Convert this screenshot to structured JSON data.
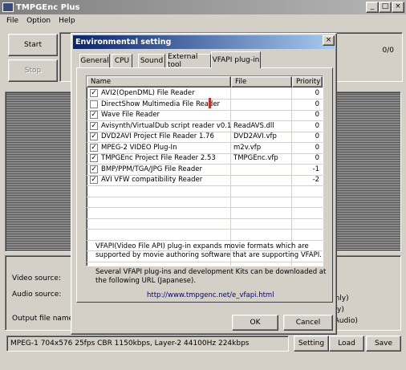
{
  "app": {
    "title": "TMPGEnc Plus"
  },
  "menu": [
    "File",
    "Option",
    "Help"
  ],
  "main": {
    "start_label": "Start",
    "stop_label": "Stop",
    "progress_count": "0/0",
    "video_source_label": "Video source:",
    "audio_source_label": "Audio source:",
    "output_label": "Output file name:",
    "right_texts": [
      "y",
      "y",
      "Video only)",
      "udio only)",
      "Video+Audio)"
    ],
    "status": "MPEG-1 704x576 25fps CBR 1150kbps, Layer-2 44100Hz 224kbps",
    "setting_label": "Setting",
    "load_label": "Load",
    "save_label": "Save"
  },
  "dialog": {
    "title": "Environmental setting",
    "tabs": [
      "General",
      "CPU",
      "Sound",
      "External tool",
      "VFAPI plug-in"
    ],
    "columns": [
      "Name",
      "File",
      "Priority"
    ],
    "plugins": [
      {
        "name": "AVI2(OpenDML) File Reader",
        "file": "",
        "priority": "0",
        "checked": true
      },
      {
        "name": "DirectShow Multimedia File Reader",
        "file": "",
        "priority": "0",
        "checked": false
      },
      {
        "name": "Wave File Reader",
        "file": "",
        "priority": "0",
        "checked": true
      },
      {
        "name": "Avisynth/VirtualDub script reader v0.1",
        "file": "ReadAVS.dll",
        "priority": "0",
        "checked": true
      },
      {
        "name": "DVD2AVI Project File Reader 1.76",
        "file": "DVD2AVI.vfp",
        "priority": "0",
        "checked": true
      },
      {
        "name": "MPEG-2 VIDEO Plug-In",
        "file": "m2v.vfp",
        "priority": "0",
        "checked": true
      },
      {
        "name": "TMPGEnc Project File Reader 2.53",
        "file": "TMPGEnc.vfp",
        "priority": "0",
        "checked": true
      },
      {
        "name": "BMP/PPM/TGA/JPG File Reader",
        "file": "",
        "priority": "-1",
        "checked": true
      },
      {
        "name": "AVI VFW compatibility Reader",
        "file": "",
        "priority": "-2",
        "checked": true
      }
    ],
    "desc1_line1": "VFAPI(Video File API) plug-in expands movie formats which are",
    "desc1_line2": "supported by movie authoring software that are supporting VFAPI.",
    "desc2_line1": "Several VFAPI plug-ins and development Kits can be downloaded at",
    "desc2_line2": "the following URL (Japanese).",
    "link": "http://www.tmpgenc.net/e_vfapi.html",
    "ok_label": "OK",
    "cancel_label": "Cancel"
  }
}
